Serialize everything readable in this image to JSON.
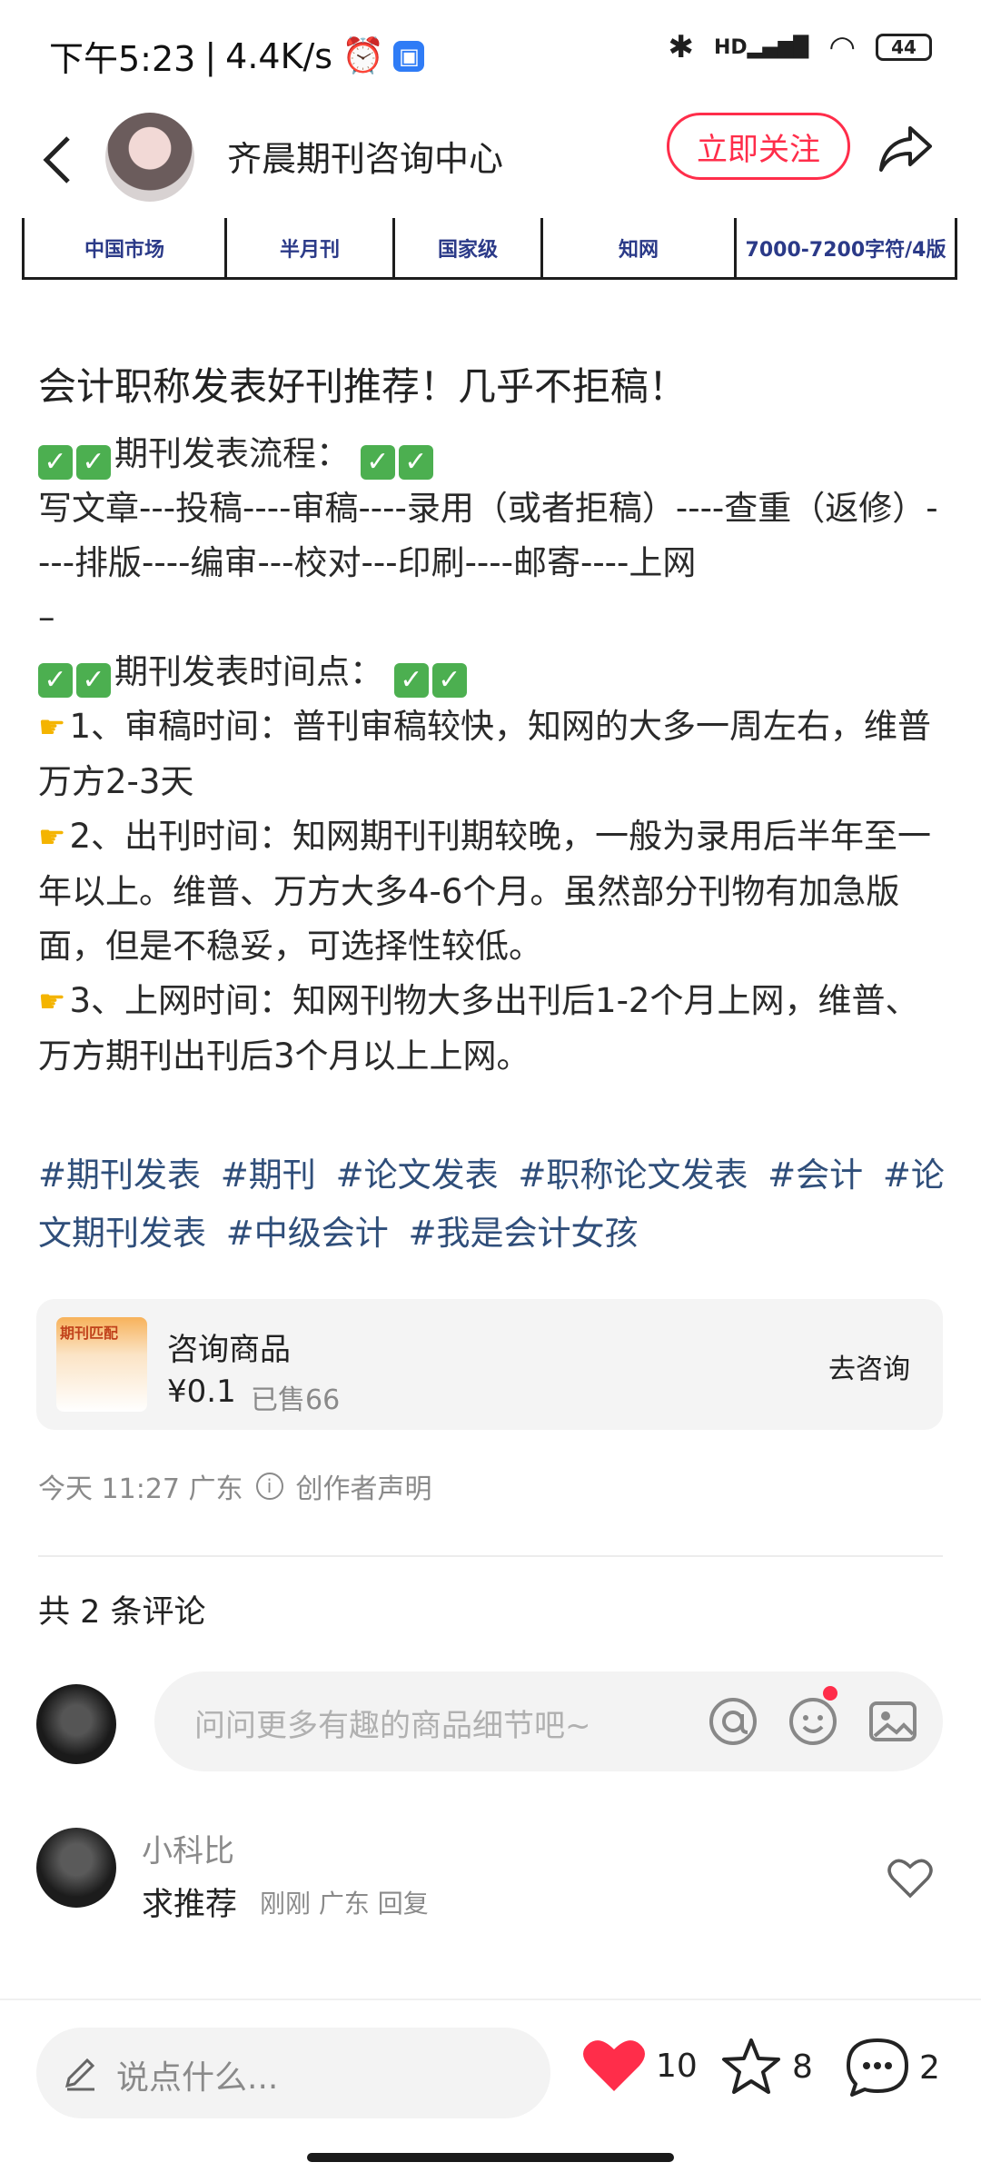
{
  "status_bar": {
    "time": "下午5:23",
    "speed": "4.4K/s",
    "battery": "44",
    "network_label": "HD"
  },
  "nav": {
    "author_name": "齐晨期刊咨询中心",
    "follow_label": "立即关注"
  },
  "info_table": {
    "cells": [
      "中国市场",
      "半月刊",
      "国家级",
      "知网",
      "7000-7200字符/4版"
    ]
  },
  "post": {
    "title": "会计职称发表好刊推荐！几乎不拒稿！",
    "process_heading": "期刊发表流程：",
    "process_text": "写文章---投稿----审稿----录用（或者拒稿）----查重（返修）----排版----编审---校对---印刷----邮寄----上网",
    "dash": "–",
    "time_heading": "期刊发表时间点：",
    "point1": "1、审稿时间：普刊审稿较快，知网的大多一周左右，维普万方2-3天",
    "point2": "2、出刊时间：知网期刊刊期较晚，一般为录用后半年至一年以上。维普、万方大多4-6个月。虽然部分刊物有加急版面，但是不稳妥，可选择性较低。",
    "point3": "3、上网时间：知网刊物大多出刊后1-2个月上网，维普、万方期刊出刊后3个月以上上网。"
  },
  "tags": [
    "#期刊发表",
    "#期刊",
    "#论文发表",
    "#职称论文发表",
    "#会计",
    "#论文期刊发表",
    "#中级会计",
    "#我是会计女孩"
  ],
  "product": {
    "thumb_title": "期刊匹配",
    "name": "咨询商品",
    "price": "¥0.1",
    "sold": "已售66",
    "consult_label": "去咨询"
  },
  "meta": {
    "time_location": "今天 11:27 广东",
    "declaration": "创作者声明"
  },
  "comments": {
    "count_label": "共 2 条评论",
    "input_placeholder": "问问更多有趣的商品细节吧~",
    "items": [
      {
        "name": "小科比",
        "text": "求推荐",
        "meta": "刚刚 广东 回复"
      }
    ]
  },
  "bottom_bar": {
    "say_placeholder": "说点什么...",
    "likes": "10",
    "stars": "8",
    "comments": "2",
    "like_color": "#ff2d4a"
  }
}
